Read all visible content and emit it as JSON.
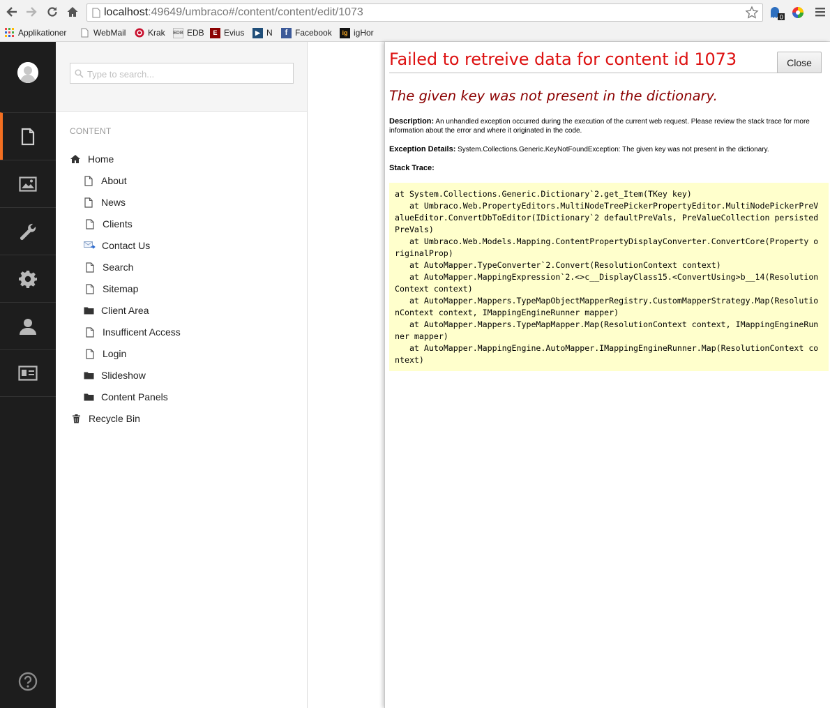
{
  "browser": {
    "url_host": "localhost",
    "url_path": ":49649/umbraco#/content/content/edit/1073",
    "bookmarks": [
      {
        "label": "Applikationer",
        "icon": "apps-grid-icon"
      },
      {
        "label": "WebMail",
        "icon": "page-icon"
      },
      {
        "label": "Krak",
        "icon": "krak-icon"
      },
      {
        "label": "EDB",
        "icon": "edb-icon"
      },
      {
        "label": "Evius",
        "icon": "evius-icon"
      },
      {
        "label": "N",
        "icon": "n-icon"
      },
      {
        "label": "Facebook",
        "icon": "facebook-icon"
      },
      {
        "label": "igHor",
        "icon": "ig-icon"
      }
    ]
  },
  "sidebar": {
    "sections": [
      "content",
      "media",
      "developer",
      "settings",
      "users",
      "members"
    ],
    "active": "content"
  },
  "tree": {
    "search_placeholder": "Type to search...",
    "heading": "Content",
    "nodes": [
      {
        "label": "Home",
        "icon": "home-icon"
      },
      {
        "label": "About",
        "icon": "document-icon"
      },
      {
        "label": "News",
        "icon": "document-icon"
      },
      {
        "label": "Clients",
        "icon": "document-icon"
      },
      {
        "label": "Contact Us",
        "icon": "mail-icon"
      },
      {
        "label": "Search",
        "icon": "document-icon"
      },
      {
        "label": "Sitemap",
        "icon": "document-icon"
      },
      {
        "label": "Client Area",
        "icon": "folder-icon"
      },
      {
        "label": "Insufficent Access",
        "icon": "document-icon"
      },
      {
        "label": "Login",
        "icon": "document-icon"
      },
      {
        "label": "Slideshow",
        "icon": "folder-icon"
      },
      {
        "label": "Content Panels",
        "icon": "folder-icon"
      },
      {
        "label": "Recycle Bin",
        "icon": "trash-icon"
      }
    ]
  },
  "dialog": {
    "title": "Failed to retreive data for content id 1073",
    "close_label": "Close",
    "subtitle": "The given key was not present in the dictionary.",
    "description_label": "Description:",
    "description_text": "An unhandled exception occurred during the execution of the current web request. Please review the stack trace for more information about the error and where it originated in the code.",
    "exception_label": "Exception Details:",
    "exception_text": "System.Collections.Generic.KeyNotFoundException: The given key was not present in the dictionary.",
    "stack_label": "Stack Trace:",
    "stack_trace": "at System.Collections.Generic.Dictionary`2.get_Item(TKey key)\n   at Umbraco.Web.PropertyEditors.MultiNodeTreePickerPropertyEditor.MultiNodePickerPreValueEditor.ConvertDbToEditor(IDictionary`2 defaultPreVals, PreValueCollection persistedPreVals)\n   at Umbraco.Web.Models.Mapping.ContentPropertyDisplayConverter.ConvertCore(Property originalProp)\n   at AutoMapper.TypeConverter`2.Convert(ResolutionContext context)\n   at AutoMapper.MappingExpression`2.<>c__DisplayClass15.<ConvertUsing>b__14(ResolutionContext context)\n   at AutoMapper.Mappers.TypeMapObjectMapperRegistry.CustomMapperStrategy.Map(ResolutionContext context, IMappingEngineRunner mapper)\n   at AutoMapper.Mappers.TypeMapMapper.Map(ResolutionContext context, IMappingEngineRunner mapper)\n   at AutoMapper.MappingEngine.AutoMapper.IMappingEngineRunner.Map(ResolutionContext context)"
  },
  "colors": {
    "accent": "#f36f21",
    "sidebar_bg": "#1d1d1d",
    "error_red": "#dd1111",
    "error_dark_red": "#8b0000",
    "trace_bg": "#ffffcc"
  }
}
